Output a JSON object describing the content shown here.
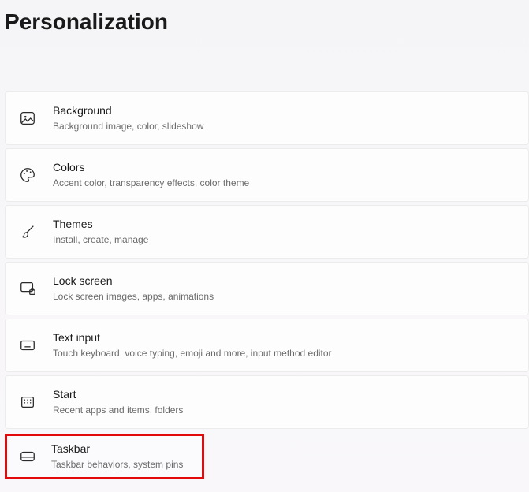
{
  "page": {
    "title": "Personalization"
  },
  "items": [
    {
      "id": "background",
      "title": "Background",
      "desc": "Background image, color, slideshow"
    },
    {
      "id": "colors",
      "title": "Colors",
      "desc": "Accent color, transparency effects, color theme"
    },
    {
      "id": "themes",
      "title": "Themes",
      "desc": "Install, create, manage"
    },
    {
      "id": "lockscreen",
      "title": "Lock screen",
      "desc": "Lock screen images, apps, animations"
    },
    {
      "id": "textinput",
      "title": "Text input",
      "desc": "Touch keyboard, voice typing, emoji and more, input method editor"
    },
    {
      "id": "start",
      "title": "Start",
      "desc": "Recent apps and items, folders"
    },
    {
      "id": "taskbar",
      "title": "Taskbar",
      "desc": "Taskbar behaviors, system pins"
    }
  ]
}
